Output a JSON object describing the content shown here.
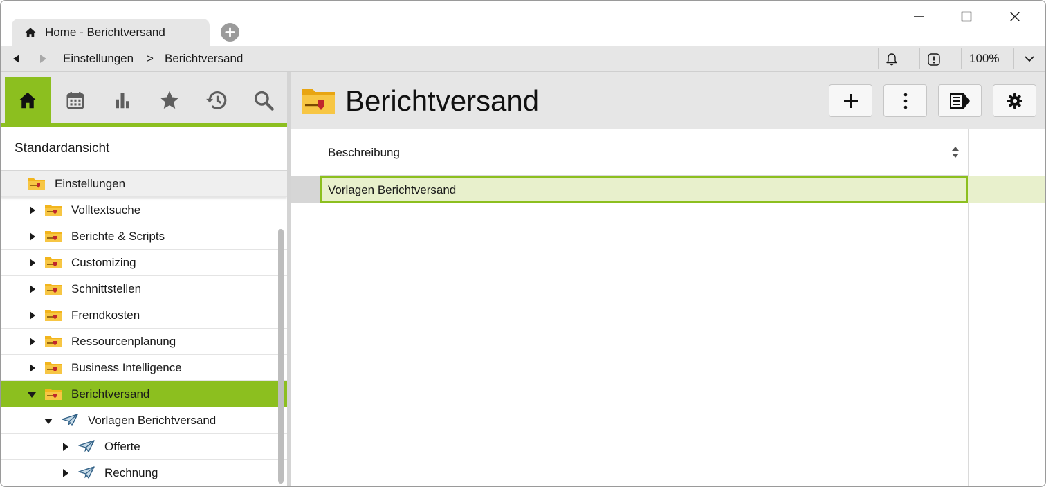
{
  "tab": {
    "title": "Home - Berichtversand",
    "icon": "home-icon"
  },
  "nav": {
    "breadcrumb": [
      "Einstellungen",
      ">",
      "Berichtversand"
    ],
    "zoom": "100%"
  },
  "sidebar": {
    "view_title": "Standardansicht",
    "tools": [
      "home-icon",
      "calendar-icon",
      "bar-chart-icon",
      "star-icon",
      "history-icon",
      "search-icon"
    ],
    "tree": [
      {
        "label": "Einstellungen",
        "level": 0,
        "state": "root"
      },
      {
        "label": "Volltextsuche",
        "level": 1,
        "state": "closed"
      },
      {
        "label": "Berichte & Scripts",
        "level": 1,
        "state": "closed"
      },
      {
        "label": "Customizing",
        "level": 1,
        "state": "closed"
      },
      {
        "label": "Schnittstellen",
        "level": 1,
        "state": "closed"
      },
      {
        "label": "Fremdkosten",
        "level": 1,
        "state": "closed"
      },
      {
        "label": "Ressourcenplanung",
        "level": 1,
        "state": "closed"
      },
      {
        "label": "Business Intelligence",
        "level": 1,
        "state": "closed"
      },
      {
        "label": "Berichtversand",
        "level": 1,
        "state": "open",
        "selected": true
      },
      {
        "label": "Vorlagen Berichtversand",
        "level": 2,
        "state": "open"
      },
      {
        "label": "Offerte",
        "level": 3,
        "state": "closed"
      },
      {
        "label": "Rechnung",
        "level": 3,
        "state": "closed"
      }
    ]
  },
  "main": {
    "title": "Berichtversand",
    "toolbar": [
      "plus-icon",
      "more-vertical-icon",
      "detail-panel-icon",
      "settings-gear-icon"
    ],
    "grid": {
      "column_header": "Beschreibung",
      "rows": [
        "Vorlagen Berichtversand"
      ]
    }
  },
  "colors": {
    "accent": "#8cbf1f",
    "selected_row": "#e8f0cc",
    "chrome": "#e6e6e6",
    "folder": "#f2b51d",
    "folder_mark": "#c0262c"
  }
}
